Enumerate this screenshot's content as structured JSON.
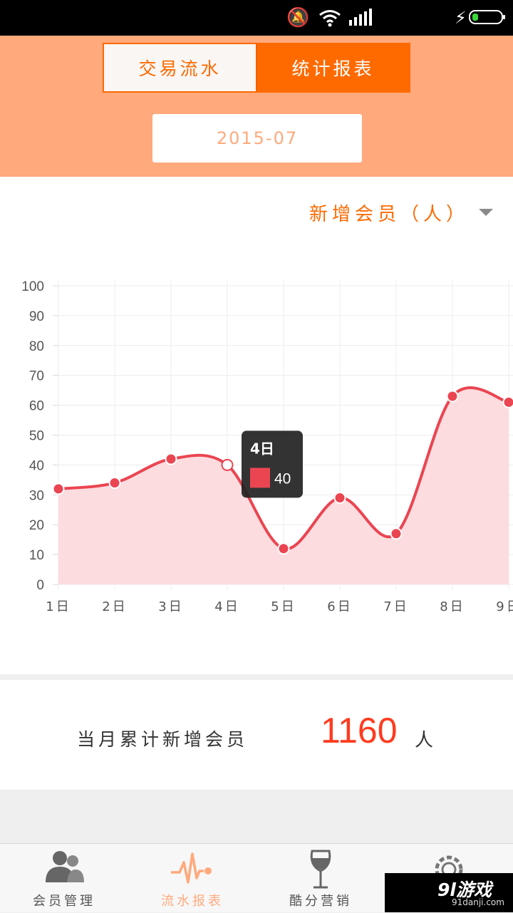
{
  "status_bar": {
    "icons": [
      "mute-icon",
      "wifi-icon",
      "signal-icon",
      "charging-bolt-icon",
      "battery-icon"
    ]
  },
  "header": {
    "tab_transactions": "交易流水",
    "tab_reports": "统计报表",
    "selected_tab": "统计报表",
    "date": "2015-07"
  },
  "metric": {
    "label": "新增会员（人）"
  },
  "chart_data": {
    "type": "area",
    "categories": [
      "1日",
      "2日",
      "3日",
      "4日",
      "5日",
      "6日",
      "7日",
      "8日",
      "9日"
    ],
    "values": [
      32,
      34,
      42,
      40,
      12,
      29,
      17,
      63,
      61
    ],
    "ylim": [
      0,
      100
    ],
    "yticks": [
      0,
      10,
      20,
      30,
      40,
      50,
      60,
      70,
      80,
      90,
      100
    ],
    "grid": true,
    "colors": {
      "line": "#ea4551",
      "fill": "#fcdcdf"
    },
    "tooltip": {
      "title": "4日",
      "value": "40",
      "swatch_color": "#ea4551"
    }
  },
  "summary": {
    "label": "当月累计新增会员",
    "value": "1160",
    "unit": "人"
  },
  "tabbar": {
    "items": [
      {
        "label": "会员管理",
        "icon": "members-icon"
      },
      {
        "label": "流水报表",
        "icon": "pulse-icon"
      },
      {
        "label": "酷分营销",
        "icon": "wine-glass-icon"
      },
      {
        "label": "",
        "icon": "gear-icon"
      }
    ],
    "active": "流水报表"
  },
  "watermark": {
    "logo": "9l游戏",
    "site": "91danji.com"
  },
  "colors": {
    "accent": "#ff6a00",
    "header_bg": "#ffa97c",
    "summary_value": "#ff3b1f"
  }
}
